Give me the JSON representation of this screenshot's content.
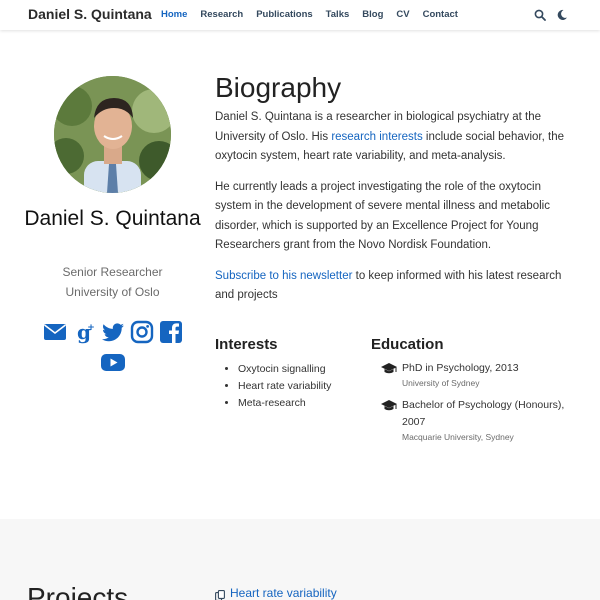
{
  "nav": {
    "brand": "Daniel S. Quintana",
    "items": [
      {
        "label": "Home",
        "active": true
      },
      {
        "label": "Research",
        "active": false
      },
      {
        "label": "Publications",
        "active": false
      },
      {
        "label": "Talks",
        "active": false
      },
      {
        "label": "Blog",
        "active": false
      },
      {
        "label": "CV",
        "active": false
      },
      {
        "label": "Contact",
        "active": false
      }
    ],
    "icons": [
      "search-icon",
      "moon-icon"
    ]
  },
  "profile": {
    "name": "Daniel S. Quintana",
    "role": "Senior Researcher",
    "organization": "University of Oslo",
    "socials": [
      "envelope-icon",
      "google-scholar-icon",
      "twitter-icon",
      "instagram-icon",
      "facebook-icon",
      "youtube-icon"
    ]
  },
  "bio": {
    "title": "Biography",
    "p1_before": "Daniel S. Quintana is a researcher in biological psychiatry at the University of Oslo. His ",
    "p1_link": "research interests",
    "p1_after": " include social behavior, the oxytocin system, heart rate variability, and meta-analysis.",
    "p2": "He currently leads a project investigating the role of the oxytocin system in the development of severe mental illness and metabolic disorder, which is supported by an Excellence Project for Young Researchers grant from the Novo Nordisk Foundation.",
    "p3_link": "Subscribe to his newsletter",
    "p3_after": " to keep informed with his latest research and projects"
  },
  "interests": {
    "title": "Interests",
    "items": [
      "Oxytocin signalling",
      "Heart rate variability",
      "Meta-research"
    ]
  },
  "education": {
    "title": "Education",
    "items": [
      {
        "degree": "PhD in Psychology, 2013",
        "institution": "University of Sydney"
      },
      {
        "degree": "Bachelor of Psychology (Honours), 2007",
        "institution": "Macquarie University, Sydney"
      }
    ]
  },
  "projects": {
    "title": "Projects",
    "first_link": "Heart rate variability"
  },
  "colors": {
    "accent": "#1565c0",
    "social": "#1565c0"
  }
}
